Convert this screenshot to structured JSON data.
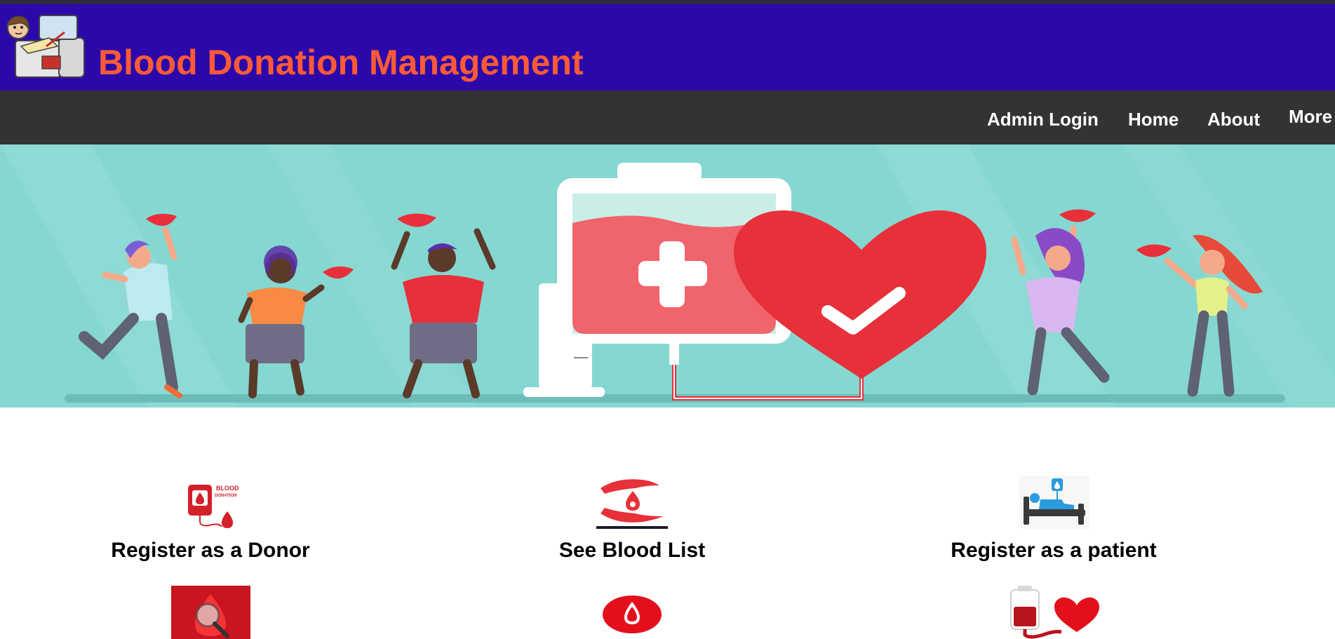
{
  "header": {
    "title": "Blood Donation Management"
  },
  "nav": {
    "admin_login": "Admin Login",
    "home": "Home",
    "about": "About",
    "more": "More"
  },
  "features": {
    "register_donor": "Register as a Donor",
    "see_blood_list": "See Blood List",
    "register_patient": "Register as a patient"
  },
  "icons": {
    "blood_bag_label_1": "BLOOD",
    "blood_bag_label_2": "DONATION"
  },
  "colors": {
    "header_bg": "#2c08ab",
    "title": "#ff5a36",
    "navbar_bg": "#333333",
    "hero_bg": "#85d7d1",
    "blood_red": "#e8303a"
  }
}
